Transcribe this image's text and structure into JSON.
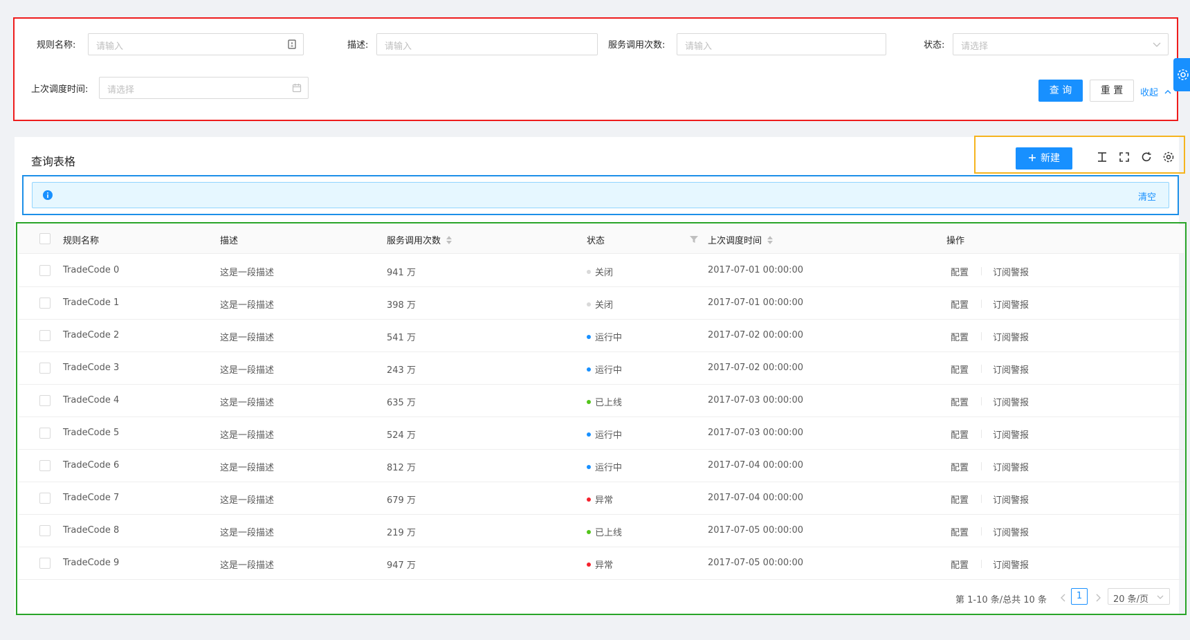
{
  "search": {
    "rule_name_label": "规则名称:",
    "rule_name_placeholder": "请输入",
    "desc_label": "描述:",
    "desc_placeholder": "请输入",
    "call_count_label": "服务调用次数:",
    "call_count_placeholder": "请输入",
    "status_label": "状态:",
    "status_placeholder": "请选择",
    "last_time_label": "上次调度时间:",
    "last_time_placeholder": "请选择",
    "query_button": "查 询",
    "reset_button": "重 置",
    "collapse_link": "收起"
  },
  "table_card": {
    "title": "查询表格",
    "new_button": "新建",
    "alert_clear": "清空"
  },
  "columns": {
    "name": "规则名称",
    "desc": "描述",
    "calls": "服务调用次数",
    "status": "状态",
    "last_time": "上次调度时间",
    "actions": "操作"
  },
  "rows": [
    {
      "name": "TradeCode 0",
      "desc": "这是一段描述",
      "calls": "941 万",
      "status": "关闭",
      "status_color": "#d9d9d9",
      "time": "2017-07-01 00:00:00",
      "action1": "配置",
      "action2": "订阅警报"
    },
    {
      "name": "TradeCode 1",
      "desc": "这是一段描述",
      "calls": "398 万",
      "status": "关闭",
      "status_color": "#d9d9d9",
      "time": "2017-07-01 00:00:00",
      "action1": "配置",
      "action2": "订阅警报"
    },
    {
      "name": "TradeCode 2",
      "desc": "这是一段描述",
      "calls": "541 万",
      "status": "运行中",
      "status_color": "#1890ff",
      "time": "2017-07-02 00:00:00",
      "action1": "配置",
      "action2": "订阅警报"
    },
    {
      "name": "TradeCode 3",
      "desc": "这是一段描述",
      "calls": "243 万",
      "status": "运行中",
      "status_color": "#1890ff",
      "time": "2017-07-02 00:00:00",
      "action1": "配置",
      "action2": "订阅警报"
    },
    {
      "name": "TradeCode 4",
      "desc": "这是一段描述",
      "calls": "635 万",
      "status": "已上线",
      "status_color": "#52c41a",
      "time": "2017-07-03 00:00:00",
      "action1": "配置",
      "action2": "订阅警报"
    },
    {
      "name": "TradeCode 5",
      "desc": "这是一段描述",
      "calls": "524 万",
      "status": "运行中",
      "status_color": "#1890ff",
      "time": "2017-07-03 00:00:00",
      "action1": "配置",
      "action2": "订阅警报"
    },
    {
      "name": "TradeCode 6",
      "desc": "这是一段描述",
      "calls": "812 万",
      "status": "运行中",
      "status_color": "#1890ff",
      "time": "2017-07-04 00:00:00",
      "action1": "配置",
      "action2": "订阅警报"
    },
    {
      "name": "TradeCode 7",
      "desc": "这是一段描述",
      "calls": "679 万",
      "status": "异常",
      "status_color": "#f5222d",
      "time": "2017-07-04 00:00:00",
      "action1": "配置",
      "action2": "订阅警报"
    },
    {
      "name": "TradeCode 8",
      "desc": "这是一段描述",
      "calls": "219 万",
      "status": "已上线",
      "status_color": "#52c41a",
      "time": "2017-07-05 00:00:00",
      "action1": "配置",
      "action2": "订阅警报"
    },
    {
      "name": "TradeCode 9",
      "desc": "这是一段描述",
      "calls": "947 万",
      "status": "异常",
      "status_color": "#f5222d",
      "time": "2017-07-05 00:00:00",
      "action1": "配置",
      "action2": "订阅警报"
    }
  ],
  "pagination": {
    "total_text": "第 1-10 条/总共 10 条",
    "current_page": "1",
    "page_size": "20 条/页"
  },
  "colors": {
    "primary": "#1890ff"
  }
}
